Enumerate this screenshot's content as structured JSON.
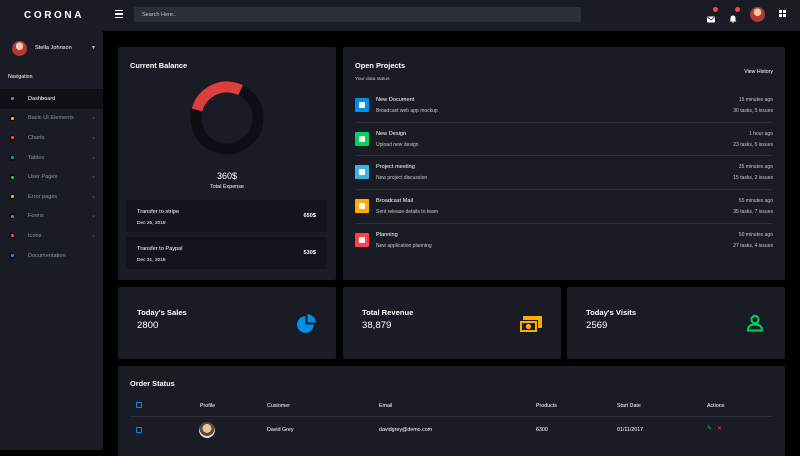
{
  "brand": "CORONA",
  "profile": {
    "name": "Stella Johnson"
  },
  "nav": {
    "heading": "Navigation",
    "items": [
      {
        "label": "Dashboard",
        "icon": "speedometer-icon",
        "color": "#8f5fe8",
        "expandable": false
      },
      {
        "label": "Basic UI Elements",
        "icon": "laptop-icon",
        "color": "#ffab00",
        "expandable": true
      },
      {
        "label": "Charts",
        "icon": "chart-bar-icon",
        "color": "#fc424a",
        "expandable": true
      },
      {
        "label": "Tables",
        "icon": "table-icon",
        "color": "#0090e7",
        "expandable": true
      },
      {
        "label": "User Pages",
        "icon": "security-icon",
        "color": "#00d25b",
        "expandable": true
      },
      {
        "label": "Error pages",
        "icon": "lock-icon",
        "color": "#ffab00",
        "expandable": true
      },
      {
        "label": "Forms",
        "icon": "playlist-play-icon",
        "color": "#8f5fe8",
        "expandable": true
      },
      {
        "label": "Icons",
        "icon": "contacts-icon",
        "color": "#fc424a",
        "expandable": true
      },
      {
        "label": "Documentation",
        "icon": "file-document-icon",
        "color": "#0090e7",
        "expandable": false
      }
    ]
  },
  "search": {
    "placeholder": "Search Here.."
  },
  "balance": {
    "title": "Current Balance",
    "amount": "360$",
    "label": "Total Expense",
    "ring_fraction": 0.28,
    "transactions": [
      {
        "name": "Transfer to stripe",
        "date": "Dec 25, 2018",
        "amount": "650$"
      },
      {
        "name": "Transfer to Paypal",
        "date": "Dec 31, 2018",
        "amount": "530$"
      }
    ]
  },
  "projects": {
    "title": "Open Projects",
    "subtitle": "Your data status",
    "view_history": "View History",
    "items": [
      {
        "name": "New Document",
        "desc": "Broadcast web app mockup",
        "time": "15 minutes ago",
        "meta": "30 tasks, 5 issues",
        "color": "#0090e7",
        "icon": "file-document-icon"
      },
      {
        "name": "New Design",
        "desc": "Upload new design",
        "time": "1 hour ago",
        "meta": "23 tasks, 5 issues",
        "color": "#00d25b",
        "icon": "cloud-download-icon"
      },
      {
        "name": "Project meeting",
        "desc": "New project discussion",
        "time": "35 minutes ago",
        "meta": "15 tasks, 2 issues",
        "color": "#3bb3e0",
        "icon": "clock-icon"
      },
      {
        "name": "Broadcast Mail",
        "desc": "Sent release details to team",
        "time": "55 minutes ago",
        "meta": "35 tasks, 7 issues",
        "color": "#ffab00",
        "icon": "email-icon"
      },
      {
        "name": "Planning",
        "desc": "New application planning",
        "time": "50 minutes ago",
        "meta": "27 tasks, 4 issues",
        "color": "#fc424a",
        "icon": "chart-pie-icon"
      }
    ]
  },
  "stats": [
    {
      "title": "Today's Sales",
      "value": "2800",
      "icon": "chart-pie-icon",
      "color": "#0090e7"
    },
    {
      "title": "Total Revenue",
      "value": "38,879",
      "icon": "cash-icon",
      "color": "#ffab00"
    },
    {
      "title": "Today's Visits",
      "value": "2569",
      "icon": "account-icon",
      "color": "#00d25b"
    }
  ],
  "orders": {
    "title": "Order Status",
    "columns": [
      "Profile",
      "Customer",
      "Email",
      "Products",
      "Start Date",
      "Actions"
    ],
    "rows": [
      {
        "customer": "David Grey",
        "email": "davidgrey@demo.com",
        "products": "6300",
        "start_date": "01/11/2017"
      }
    ]
  }
}
